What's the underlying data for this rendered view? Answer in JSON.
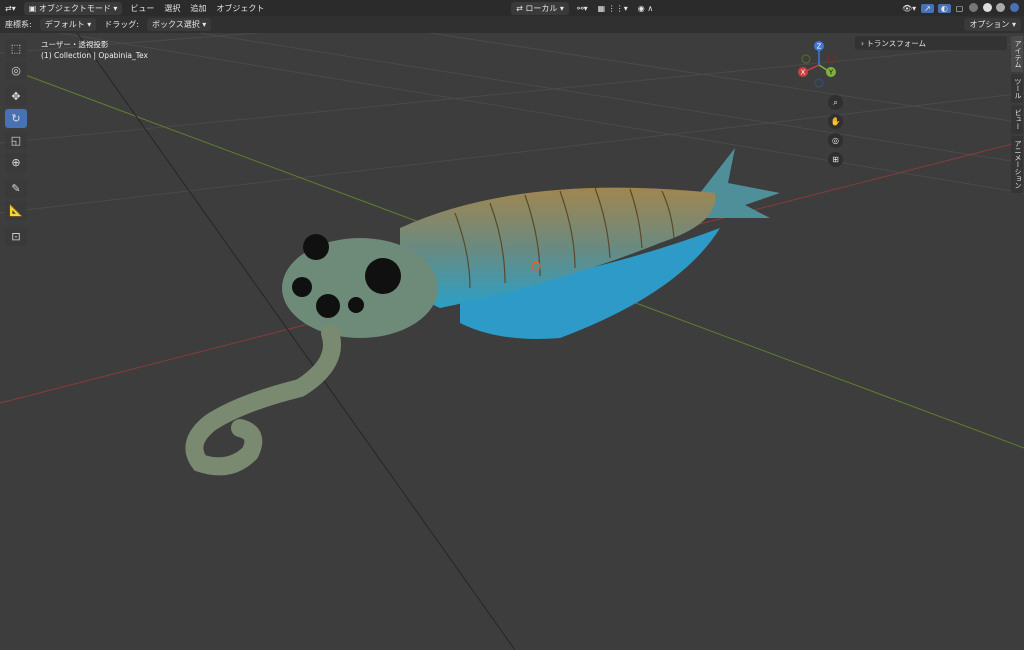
{
  "header": {
    "mode_label": "オブジェクトモード",
    "menus": [
      "ビュー",
      "選択",
      "追加",
      "オブジェクト"
    ],
    "transform_orientation": "ローカル"
  },
  "toolbar2": {
    "coord_label": "座標系:",
    "coord_value": "デフォルト",
    "drag_label": "ドラッグ:",
    "drag_value": "ボックス選択",
    "options_label": "オプション"
  },
  "viewport": {
    "view_name": "ユーザー・透視投影",
    "collection_info": "(1) Collection | Opabinia_Tex"
  },
  "gizmo": {
    "z": "Z",
    "y": "Y",
    "x": "X"
  },
  "npanel": {
    "transform_label": "トランスフォーム"
  },
  "side_tabs": [
    "アイテム",
    "ツール",
    "ビュー",
    "アニメーション"
  ],
  "colors": {
    "accent": "#4772b3",
    "x_axis": "#c9403f",
    "y_axis": "#7fb23a",
    "z_axis": "#3c78d8"
  },
  "icons": [
    "editor-type-icon",
    "object-mode-icon",
    "link-icon",
    "snap-icon",
    "proportional-icon",
    "select-box-icon",
    "cursor-icon",
    "move-icon",
    "rotate-icon",
    "scale-icon",
    "transform-icon",
    "annotate-icon",
    "measure-icon",
    "add-cube-icon",
    "zoom-icon",
    "hand-icon",
    "camera-icon",
    "grid-icon"
  ]
}
